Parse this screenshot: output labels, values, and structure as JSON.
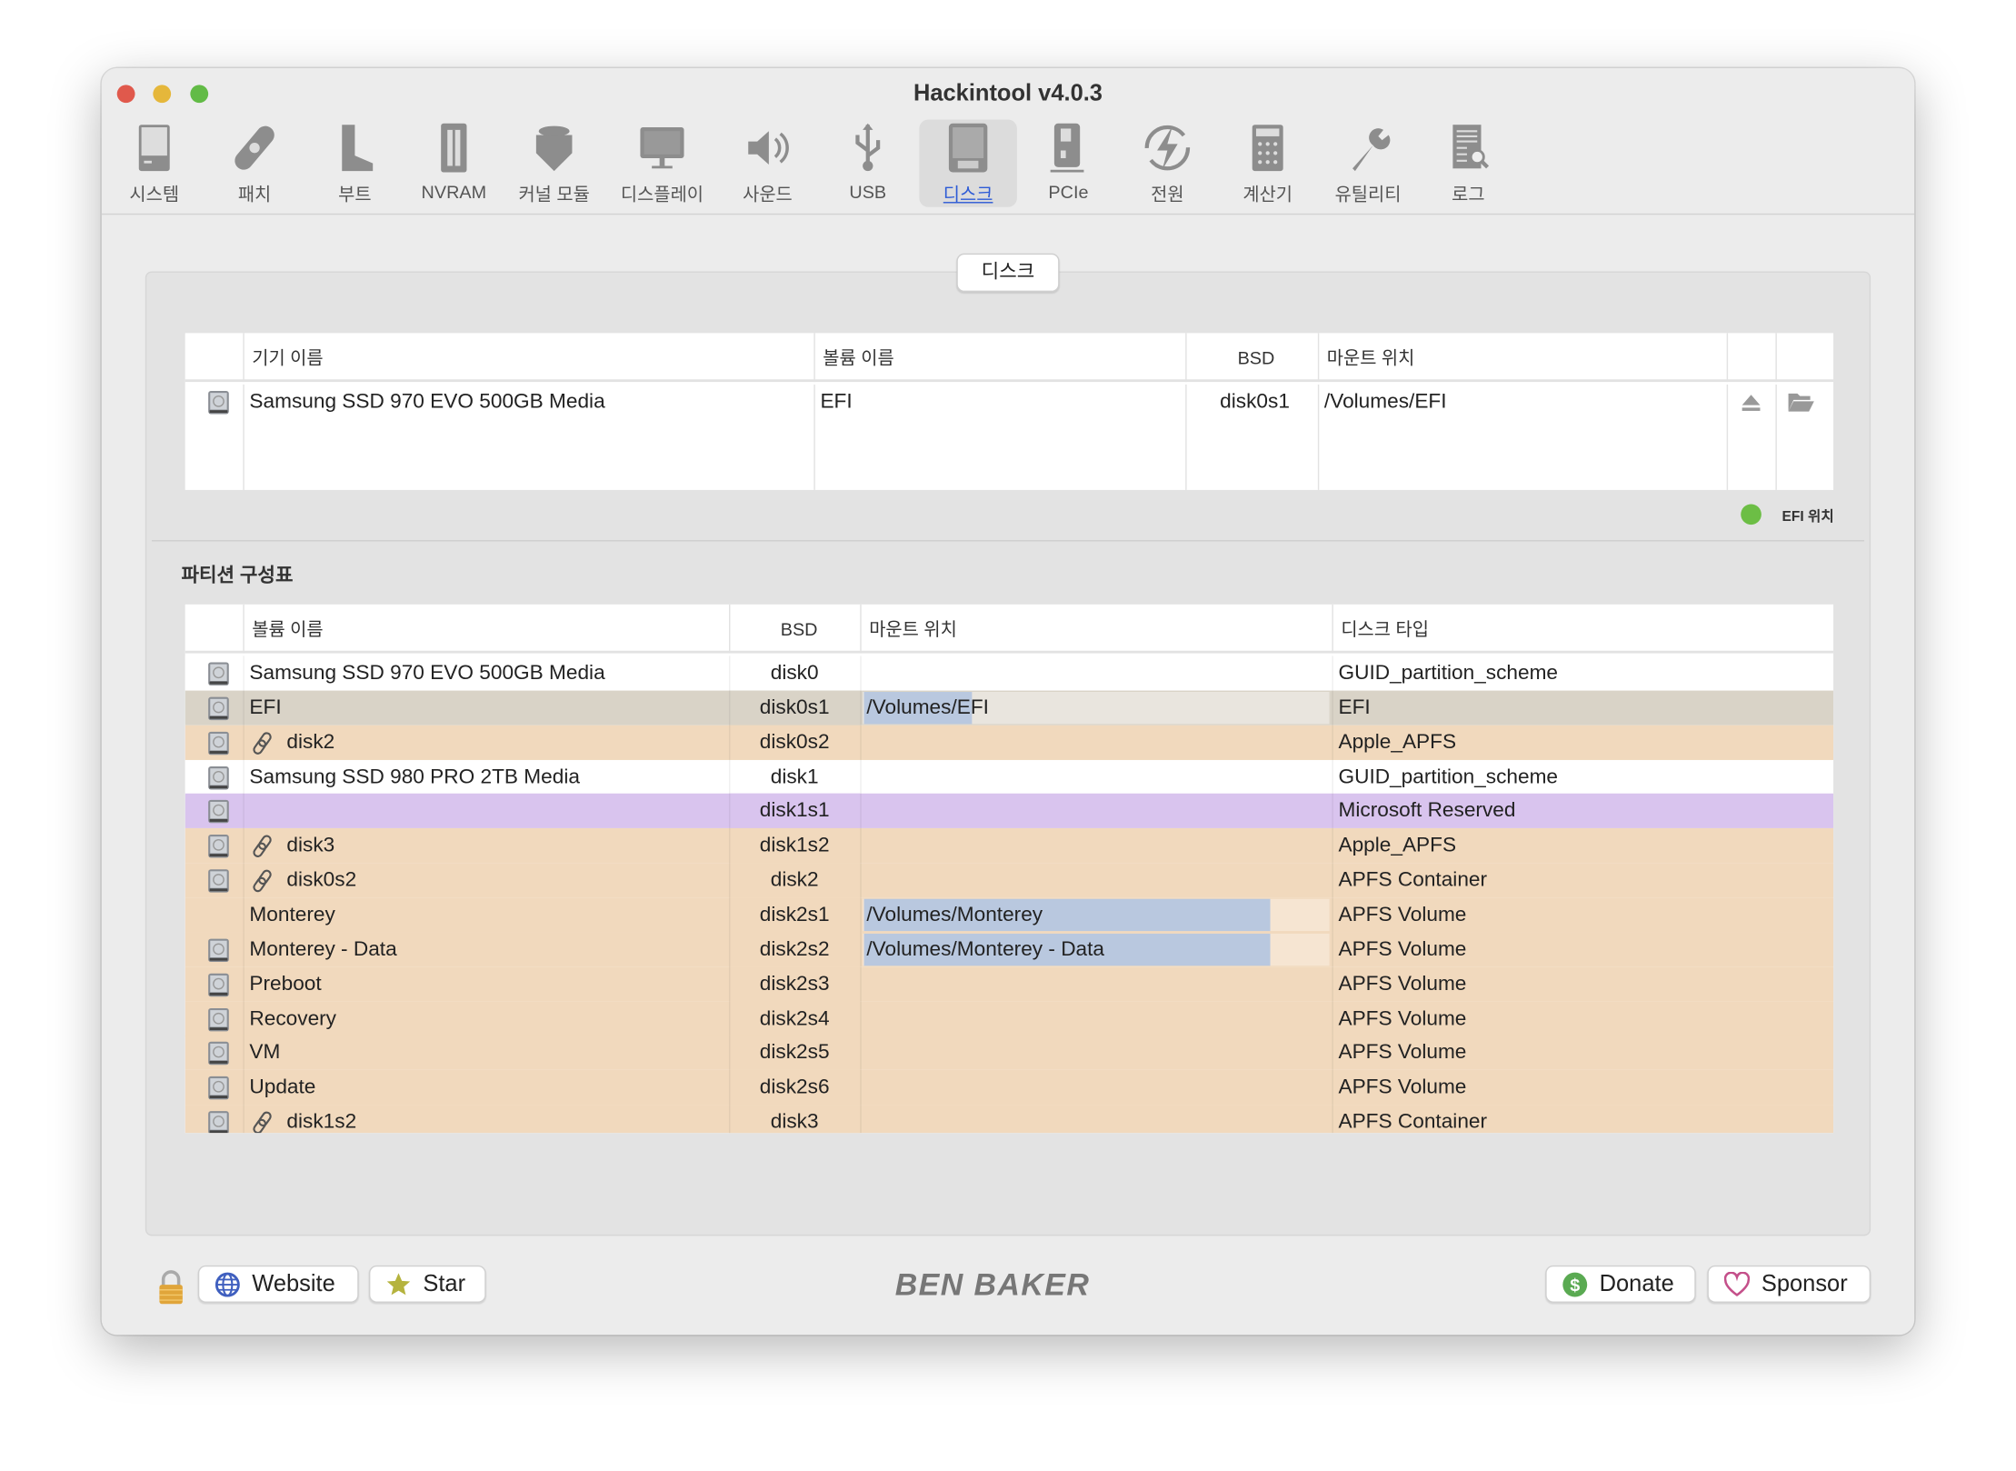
{
  "window": {
    "title": "Hackintool v4.0.3"
  },
  "toolbar": [
    {
      "label": "시스템",
      "icon": "computer-icon"
    },
    {
      "label": "패치",
      "icon": "bandage-icon"
    },
    {
      "label": "부트",
      "icon": "boot-icon"
    },
    {
      "label": "NVRAM",
      "icon": "memory-icon"
    },
    {
      "label": "커널 모듈",
      "icon": "lego-brick-icon"
    },
    {
      "label": "디스플레이",
      "icon": "monitor-icon"
    },
    {
      "label": "사운드",
      "icon": "speaker-icon"
    },
    {
      "label": "USB",
      "icon": "usb-icon"
    },
    {
      "label": "디스크",
      "icon": "disk-icon",
      "selected": true
    },
    {
      "label": "PCIe",
      "icon": "pcie-card-icon"
    },
    {
      "label": "전원",
      "icon": "power-bolt-icon"
    },
    {
      "label": "계산기",
      "icon": "calculator-icon"
    },
    {
      "label": "유틸리티",
      "icon": "wrench-icon"
    },
    {
      "label": "로그",
      "icon": "log-search-icon"
    }
  ],
  "tab": "디스크",
  "efi_table": {
    "headers": [
      "기기 이름",
      "볼륨 이름",
      "BSD",
      "마운트 위치"
    ],
    "rows": [
      {
        "device": "Samsung SSD 970 EVO 500GB Media",
        "volume": "EFI",
        "bsd": "disk0s1",
        "mount": "/Volumes/EFI"
      }
    ]
  },
  "legend": {
    "label": "EFI 위치",
    "color": "#6cbe45"
  },
  "partition_section": {
    "title": "파티션 구성표"
  },
  "partition_table": {
    "headers": [
      "볼륨 이름",
      "BSD",
      "마운트 위치",
      "디스크 타입"
    ],
    "rows": [
      {
        "name": "Samsung SSD 970 EVO 500GB Media",
        "bsd": "disk0",
        "mount": "",
        "type": "GUID_partition_scheme",
        "color": "#ffffff",
        "icon": true,
        "link": false
      },
      {
        "name": "EFI",
        "bsd": "disk0s1",
        "mount": "/Volumes/EFI",
        "type": "EFI",
        "color": "#d9d3c7",
        "icon": true,
        "link": false
      },
      {
        "name": "disk2",
        "bsd": "disk0s2",
        "mount": "",
        "type": "Apple_APFS",
        "color": "#f1d9bd",
        "icon": true,
        "link": true
      },
      {
        "name": "Samsung SSD 980 PRO 2TB Media",
        "bsd": "disk1",
        "mount": "",
        "type": "GUID_partition_scheme",
        "color": "#ffffff",
        "icon": true,
        "link": false
      },
      {
        "name": "",
        "bsd": "disk1s1",
        "mount": "",
        "type": "Microsoft Reserved",
        "color": "#d9c4ee",
        "icon": true,
        "link": false
      },
      {
        "name": "disk3",
        "bsd": "disk1s2",
        "mount": "",
        "type": "Apple_APFS",
        "color": "#f1d9bd",
        "icon": true,
        "link": true
      },
      {
        "name": "disk0s2",
        "bsd": "disk2",
        "mount": "",
        "type": "APFS Container",
        "color": "#f1d9bd",
        "icon": true,
        "link": true
      },
      {
        "name": "Monterey",
        "bsd": "disk2s1",
        "mount": "/Volumes/Monterey",
        "type": "APFS Volume",
        "color": "#f1d9bd",
        "icon": false,
        "link": false
      },
      {
        "name": "Monterey - Data",
        "bsd": "disk2s2",
        "mount": "/Volumes/Monterey - Data",
        "type": "APFS Volume",
        "color": "#f1d9bd",
        "icon": true,
        "link": false
      },
      {
        "name": "Preboot",
        "bsd": "disk2s3",
        "mount": "",
        "type": "APFS Volume",
        "color": "#f1d9bd",
        "icon": true,
        "link": false
      },
      {
        "name": "Recovery",
        "bsd": "disk2s4",
        "mount": "",
        "type": "APFS Volume",
        "color": "#f1d9bd",
        "icon": true,
        "link": false
      },
      {
        "name": "VM",
        "bsd": "disk2s5",
        "mount": "",
        "type": "APFS Volume",
        "color": "#f1d9bd",
        "icon": true,
        "link": false
      },
      {
        "name": "Update",
        "bsd": "disk2s6",
        "mount": "",
        "type": "APFS Volume",
        "color": "#f1d9bd",
        "icon": true,
        "link": false
      },
      {
        "name": "disk1s2",
        "bsd": "disk3",
        "mount": "",
        "type": "APFS Container",
        "color": "#f1d9bd",
        "icon": true,
        "link": true
      }
    ]
  },
  "footer": {
    "website": "Website",
    "star": "Star",
    "logo": "BEN BAKER",
    "donate": "Donate",
    "sponsor": "Sponsor"
  }
}
